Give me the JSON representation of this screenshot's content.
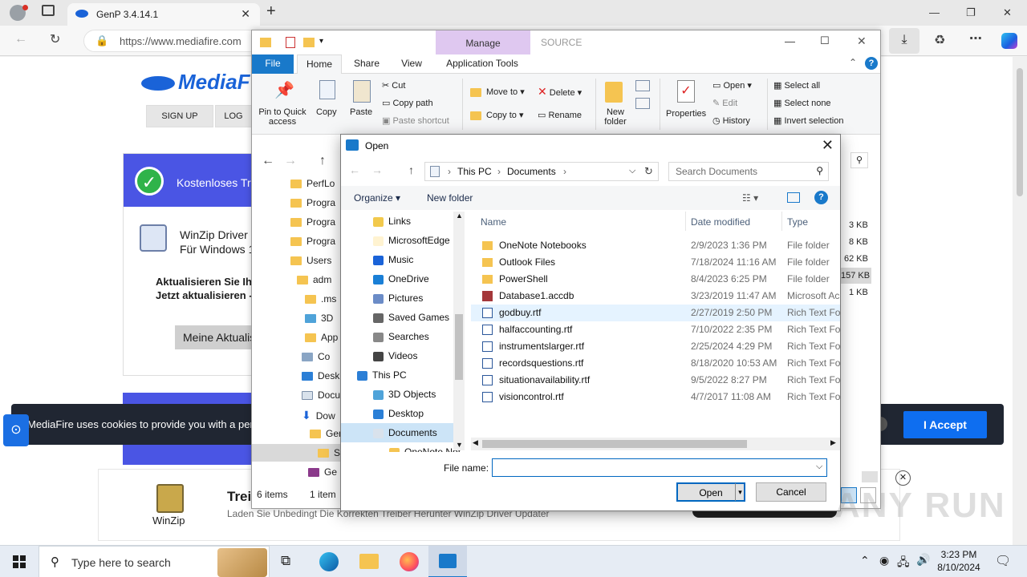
{
  "browser": {
    "tab_title": "GenP 3.4.14.1",
    "address": "https://www.mediafire.com",
    "tab_close": "✕",
    "new_tab": "+"
  },
  "webpage": {
    "logo": "MediaF",
    "nav": [
      "SIGN UP",
      "LOG"
    ],
    "card_title": "Kostenloses Tr",
    "product_title": "WinZip Driver U",
    "product_sub": "Für Windows 1",
    "update_line1": "Aktualisieren Sie Ihr",
    "update_line2": "Jetzt aktualisieren -",
    "update_button": "Meine Aktualis",
    "cookie_text": "MediaFire uses cookies to provide you with a pers",
    "accept_label": "I Accept",
    "ad_title": "Trei",
    "ad_sub": "Laden Sie Unbedingt Die Korrekten Treiber Herunter WinZip Driver Updater",
    "ad_logo": "WinZip"
  },
  "explorer": {
    "manage_tab": "Manage",
    "source_label": "SOURCE",
    "tabs": [
      "File",
      "Home",
      "Share",
      "View",
      "Application Tools"
    ],
    "ribbon": {
      "pin": "Pin to Quick access",
      "copy": "Copy",
      "paste": "Paste",
      "cut": "Cut",
      "copy_path": "Copy path",
      "paste_shortcut": "Paste shortcut",
      "move_to": "Move to",
      "copy_to": "Copy to",
      "delete": "Delete",
      "rename": "Rename",
      "new_folder": "New folder",
      "properties": "Properties",
      "open": "Open",
      "edit": "Edit",
      "history": "History",
      "select_all": "Select all",
      "select_none": "Select none",
      "invert_selection": "Invert selection"
    },
    "sidebar": [
      "PerfLo",
      "Progra",
      "Progra",
      "Progra",
      "Users",
      "adm",
      ".ms",
      "3D",
      "App",
      "Co",
      "Desk",
      "Docu",
      "Dow",
      "Gen",
      "SO",
      "Ge"
    ],
    "sizes": [
      "3 KB",
      "8 KB",
      "62 KB",
      "157 KB",
      "1 KB"
    ],
    "status_items": "6 items",
    "status_selected": "1 item"
  },
  "dialog": {
    "title": "Open",
    "breadcrumb": [
      "This PC",
      "Documents"
    ],
    "search_placeholder": "Search Documents",
    "organize": "Organize",
    "new_folder": "New folder",
    "nav_items": [
      {
        "label": "Links",
        "indent": 2
      },
      {
        "label": "MicrosoftEdge",
        "indent": 2
      },
      {
        "label": "Music",
        "indent": 2
      },
      {
        "label": "OneDrive",
        "indent": 2
      },
      {
        "label": "Pictures",
        "indent": 2
      },
      {
        "label": "Saved Games",
        "indent": 2
      },
      {
        "label": "Searches",
        "indent": 2
      },
      {
        "label": "Videos",
        "indent": 2
      },
      {
        "label": "This PC",
        "indent": 1
      },
      {
        "label": "3D Objects",
        "indent": 2
      },
      {
        "label": "Desktop",
        "indent": 2
      },
      {
        "label": "Documents",
        "indent": 2
      },
      {
        "label": "OneNote Not",
        "indent": 3
      }
    ],
    "columns": [
      "Name",
      "Date modified",
      "Type"
    ],
    "files": [
      {
        "name": "OneNote Notebooks",
        "date": "2/9/2023 1:36 PM",
        "type": "File folder",
        "kind": "folder"
      },
      {
        "name": "Outlook Files",
        "date": "7/18/2024 11:16 AM",
        "type": "File folder",
        "kind": "folder"
      },
      {
        "name": "PowerShell",
        "date": "8/4/2023 6:25 PM",
        "type": "File folder",
        "kind": "folder"
      },
      {
        "name": "Database1.accdb",
        "date": "3/23/2019 11:47 AM",
        "type": "Microsoft Ac",
        "kind": "access"
      },
      {
        "name": "godbuy.rtf",
        "date": "2/27/2019 2:50 PM",
        "type": "Rich Text For",
        "kind": "rtf"
      },
      {
        "name": "halfaccounting.rtf",
        "date": "7/10/2022 2:35 PM",
        "type": "Rich Text For",
        "kind": "rtf"
      },
      {
        "name": "instrumentslarger.rtf",
        "date": "2/25/2024 4:29 PM",
        "type": "Rich Text For",
        "kind": "rtf"
      },
      {
        "name": "recordsquestions.rtf",
        "date": "8/18/2020 10:53 AM",
        "type": "Rich Text For",
        "kind": "rtf"
      },
      {
        "name": "situationavailability.rtf",
        "date": "9/5/2022 8:27 PM",
        "type": "Rich Text For",
        "kind": "rtf"
      },
      {
        "name": "visioncontrol.rtf",
        "date": "4/7/2017 11:08 AM",
        "type": "Rich Text For",
        "kind": "rtf"
      }
    ],
    "filename_label": "File name:",
    "filename_value": "",
    "open_button": "Open",
    "cancel_button": "Cancel"
  },
  "taskbar": {
    "search_placeholder": "Type here to search",
    "time": "3:23 PM",
    "date": "8/10/2024"
  },
  "watermark": "ANY RUN",
  "colors": {
    "accent": "#0067c0",
    "explorer_file_tab": "#1979ca",
    "manage_tab": "#dfc8f0",
    "accept_button": "#0e6ef0",
    "folder": "#f5c451"
  }
}
